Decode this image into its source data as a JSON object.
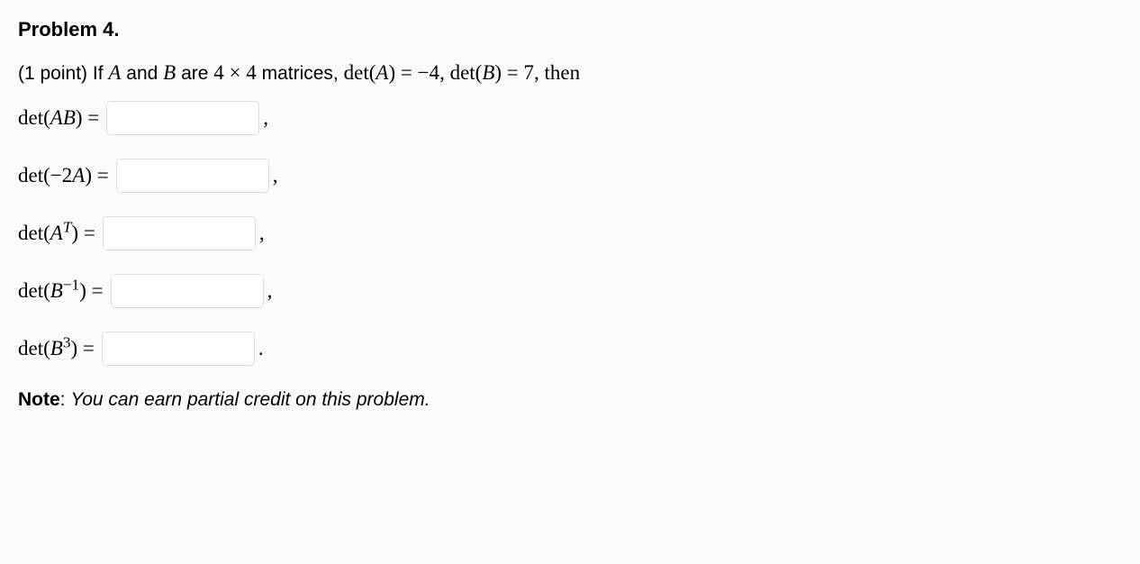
{
  "title": "Problem 4.",
  "intro": {
    "points_prefix": "(1 point) If ",
    "A": "A",
    "and": " and ",
    "B": "B",
    "are": " are ",
    "dim": "4 × 4",
    "matrices": " matrices, ",
    "detA_lbl": "det(",
    "detA_var": "A",
    "detA_close": ") = ",
    "detA_val": "−4",
    "sep1": ", ",
    "detB_lbl": "det(",
    "detB_var": "B",
    "detB_close": ") = ",
    "detB_val": "7",
    "then": ", then"
  },
  "rows": {
    "r1": {
      "pre": "det(",
      "var": "AB",
      "post": ") = ",
      "punct": ","
    },
    "r2": {
      "pre": "det(",
      "var": "−2A",
      "post": ") = ",
      "punct": ","
    },
    "r3": {
      "pre": "det(",
      "var": "A",
      "sup": "T",
      "post": ") = ",
      "punct": ","
    },
    "r4": {
      "pre": "det(",
      "var": "B",
      "sup": "−1",
      "post": ") = ",
      "punct": ","
    },
    "r5": {
      "pre": "det(",
      "var": "B",
      "sup": "3",
      "post": ") = ",
      "punct": "."
    }
  },
  "note": {
    "label": "Note",
    "sep": ": ",
    "text": "You can earn partial credit on this problem."
  }
}
